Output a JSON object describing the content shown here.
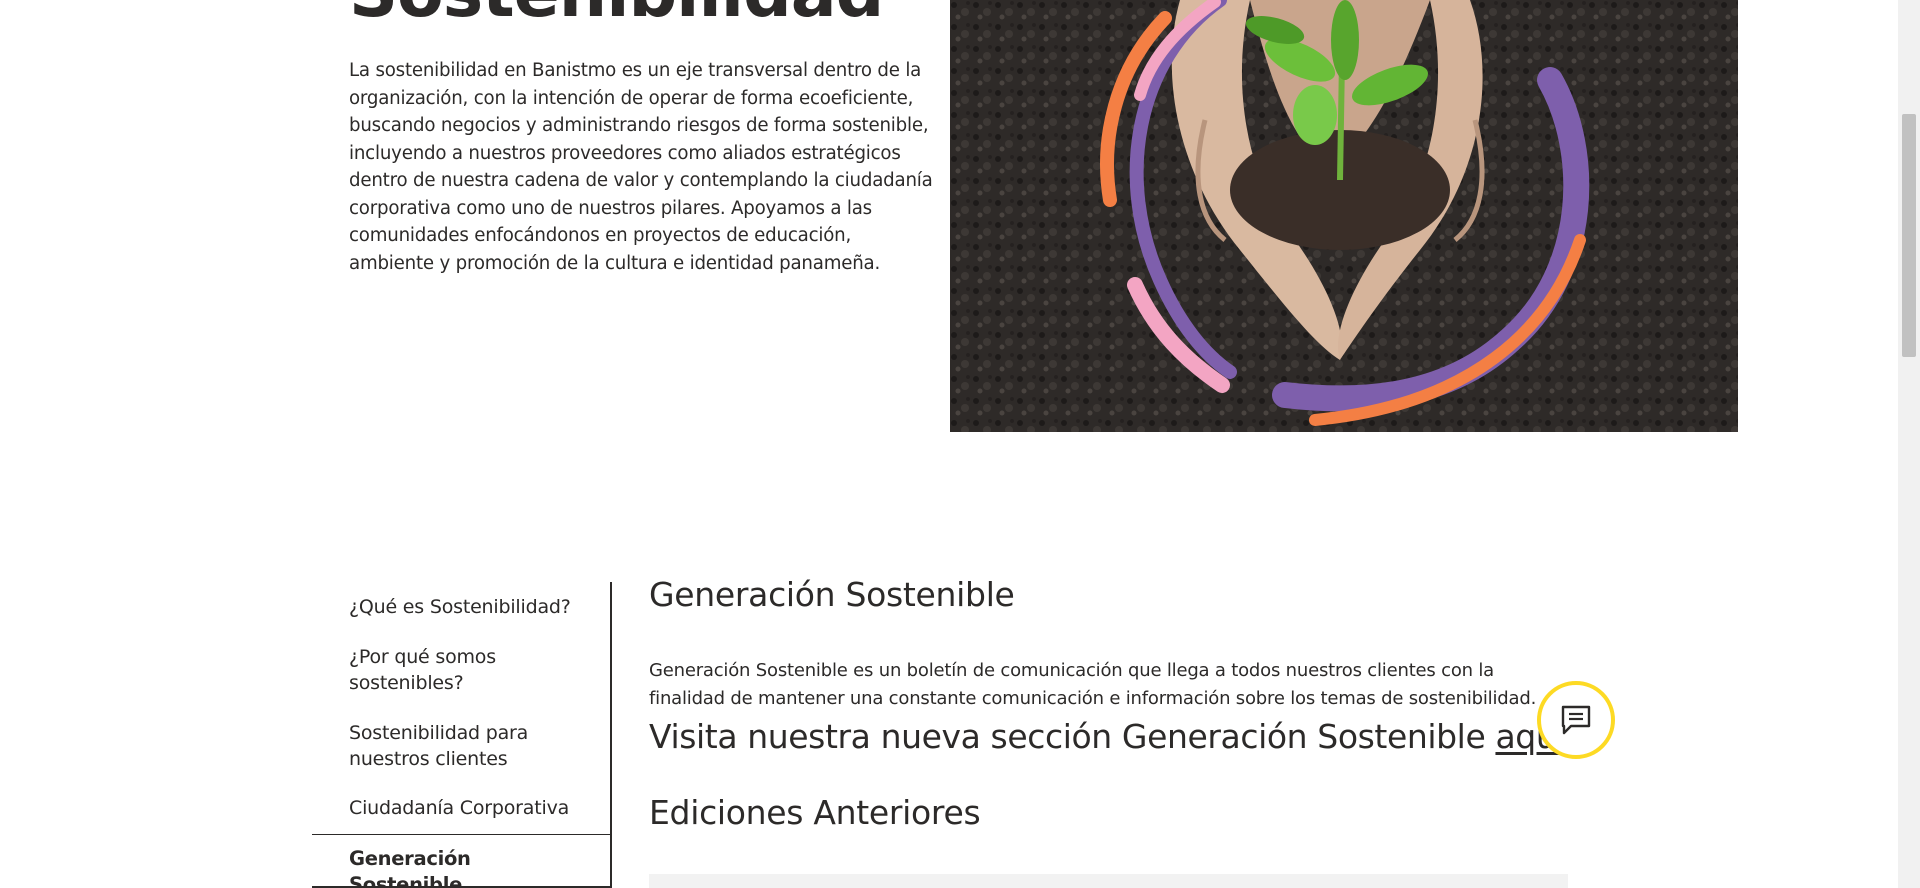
{
  "hero": {
    "title": "Sostenibilidad",
    "description": "La sostenibilidad en Banistmo es un eje transversal dentro de la organización, con la intención de operar de forma ecoeficiente, buscando negocios y administrando riesgos de forma sostenible, incluyendo a nuestros proveedores como aliados estratégicos dentro de nuestra cadena de valor y contemplando la ciudadanía corporativa como uno de nuestros pilares.  Apoyamos a las comunidades enfocándonos en proyectos de educación, ambiente y promoción de la cultura e identidad panameña.",
    "image": "hands-holding-seedling-in-soil-photo",
    "ring_colors": [
      "#7e5fac",
      "#f47f44",
      "#f3a5c3"
    ]
  },
  "side_nav": {
    "items": [
      {
        "label": "¿Qué es Sostenibilidad?",
        "active": false
      },
      {
        "label": "¿Por qué somos sostenibles?",
        "active": false
      },
      {
        "label": "Sostenibilidad para nuestros clientes",
        "active": false
      },
      {
        "label": "Ciudadanía Corporativa",
        "active": false
      },
      {
        "label": "Generación Sostenible",
        "active": true
      }
    ]
  },
  "content": {
    "title": "Generación Sostenible",
    "description": "Generación Sostenible es un boletín de comunicación que llega a todos nuestros clientes con la finalidad de mantener una constante comunicación e información sobre los temas de sostenibilidad.",
    "visit_prefix": "Visita nuestra nueva sección Generación Sostenible ",
    "visit_link": "aquí",
    "previous_title": "Ediciones Anteriores"
  },
  "chat": {
    "icon": "chat-bubble-icon",
    "accent": "#fdda24"
  },
  "colors": {
    "text": "#2c2a29",
    "accent": "#fdda24"
  }
}
